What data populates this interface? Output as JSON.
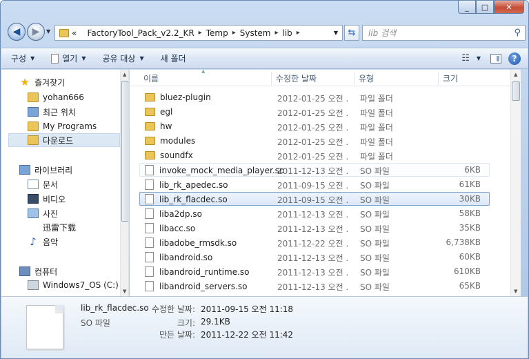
{
  "window": {
    "controls": [
      "_",
      "□",
      "✕"
    ]
  },
  "address": {
    "crumbs": [
      "FactoryTool_Pack_v2.2_KR",
      "Temp",
      "System",
      "lib"
    ],
    "prefix": "«"
  },
  "search": {
    "placeholder": "lib 검색"
  },
  "toolbar": {
    "organize": "구성",
    "open": "열기",
    "share": "공유 대상",
    "new_folder": "새 폴더"
  },
  "nav": {
    "favorites": "즐겨찾기",
    "fav_items": [
      "yohan666",
      "최근 위치",
      "My Programs",
      "다운로드"
    ],
    "libraries": "라이브러리",
    "lib_items": [
      "문서",
      "비디오",
      "사진",
      "迅雷下载",
      "음악"
    ],
    "computer": "컴퓨터",
    "drives": [
      "Windows7_OS (C:)"
    ]
  },
  "columns": {
    "name": "이름",
    "date": "수정한 날짜",
    "type": "유형",
    "size": "크기"
  },
  "files": [
    {
      "name": "bluez-plugin",
      "date": "2012-01-25 오전 ...",
      "type": "파일 폴더",
      "size": "",
      "kind": "folder"
    },
    {
      "name": "egl",
      "date": "2012-01-25 오전 ...",
      "type": "파일 폴더",
      "size": "",
      "kind": "folder"
    },
    {
      "name": "hw",
      "date": "2012-01-25 오전 ...",
      "type": "파일 폴더",
      "size": "",
      "kind": "folder"
    },
    {
      "name": "modules",
      "date": "2012-01-25 오전 ...",
      "type": "파일 폴더",
      "size": "",
      "kind": "folder"
    },
    {
      "name": "soundfx",
      "date": "2012-01-25 오전 ...",
      "type": "파일 폴더",
      "size": "",
      "kind": "folder"
    },
    {
      "name": "invoke_mock_media_player.so",
      "date": "2011-12-13 오전 ...",
      "type": "SO 파일",
      "size": "6KB",
      "kind": "file"
    },
    {
      "name": "lib_rk_apedec.so",
      "date": "2011-09-15 오전 ...",
      "type": "SO 파일",
      "size": "61KB",
      "kind": "file"
    },
    {
      "name": "lib_rk_flacdec.so",
      "date": "2011-09-15 오전 ...",
      "type": "SO 파일",
      "size": "30KB",
      "kind": "file"
    },
    {
      "name": "liba2dp.so",
      "date": "2011-12-13 오전 ...",
      "type": "SO 파일",
      "size": "58KB",
      "kind": "file"
    },
    {
      "name": "libacc.so",
      "date": "2011-12-13 오전 ...",
      "type": "SO 파일",
      "size": "35KB",
      "kind": "file"
    },
    {
      "name": "libadobe_rmsdk.so",
      "date": "2011-12-22 오전 ...",
      "type": "SO 파일",
      "size": "6,738KB",
      "kind": "file"
    },
    {
      "name": "libandroid.so",
      "date": "2011-12-13 오전 ...",
      "type": "SO 파일",
      "size": "60KB",
      "kind": "file"
    },
    {
      "name": "libandroid_runtime.so",
      "date": "2011-12-13 오전 ...",
      "type": "SO 파일",
      "size": "610KB",
      "kind": "file"
    },
    {
      "name": "libandroid_servers.so",
      "date": "2011-12-13 오전 ...",
      "type": "SO 파일",
      "size": "65KB",
      "kind": "file"
    }
  ],
  "details": {
    "name": "lib_rk_flacdec.so",
    "type": "SO 파일",
    "modified_label": "수정한 날짜:",
    "modified": "2011-09-15 오전 11:18",
    "size_label": "크기:",
    "size": "29.1KB",
    "created_label": "만든 날짜:",
    "created": "2011-12-22 오전 11:42"
  }
}
